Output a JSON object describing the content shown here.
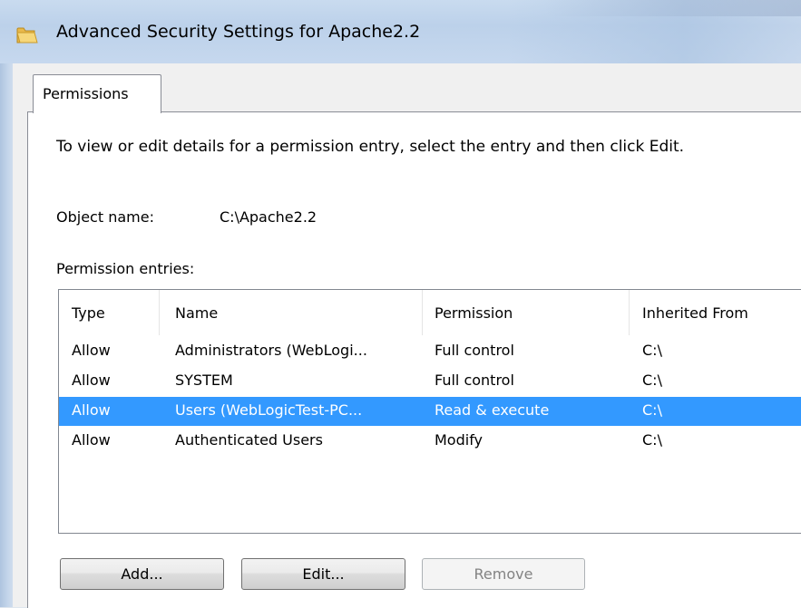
{
  "window": {
    "title": "Advanced Security Settings for Apache2.2",
    "icon": "folder-icon"
  },
  "tabs": [
    {
      "label": "Permissions",
      "active": true
    }
  ],
  "panel": {
    "instruction": "To view or edit details for a permission entry, select the entry and then click Edit.",
    "object_name_label": "Object name:",
    "object_name_value": "C:\\Apache2.2",
    "entries_label": "Permission entries:"
  },
  "table": {
    "columns": [
      "Type",
      "Name",
      "Permission",
      "Inherited From"
    ],
    "rows": [
      {
        "type": "Allow",
        "name": "Administrators (WebLogi...",
        "permission": "Full control",
        "inherited": "C:\\",
        "selected": false
      },
      {
        "type": "Allow",
        "name": "SYSTEM",
        "permission": "Full control",
        "inherited": "C:\\",
        "selected": false
      },
      {
        "type": "Allow",
        "name": "Users (WebLogicTest-PC...",
        "permission": "Read & execute",
        "inherited": "C:\\",
        "selected": true
      },
      {
        "type": "Allow",
        "name": "Authenticated Users",
        "permission": "Modify",
        "inherited": "C:\\",
        "selected": false
      }
    ]
  },
  "buttons": {
    "add": "Add...",
    "edit": "Edit...",
    "remove": "Remove"
  },
  "colors": {
    "selection": "#3399ff",
    "titlebar": "#c9dbef",
    "dialog_bg": "#f0f0f0"
  }
}
